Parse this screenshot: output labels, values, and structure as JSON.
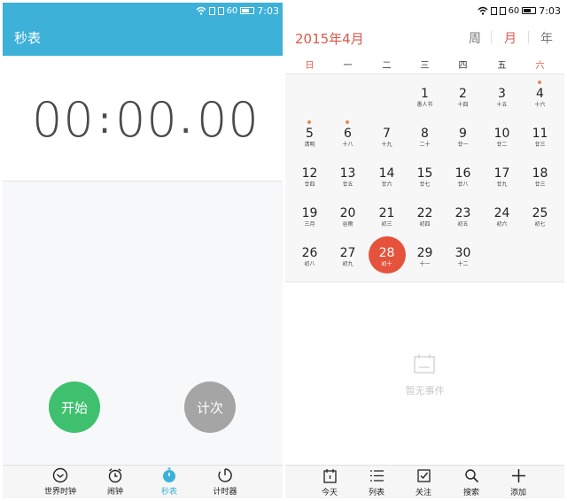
{
  "stopwatch": {
    "status": {
      "signal": "60",
      "time": "7:03"
    },
    "title": "秒表",
    "display": {
      "minutes": "00",
      "sep1": ":",
      "seconds": "00",
      "sep2": ".",
      "hundredths": "00"
    },
    "start_label": "开始",
    "lap_label": "计次",
    "tabs": [
      {
        "label": "世界时钟",
        "icon": "globe-clock-icon",
        "active": false
      },
      {
        "label": "闹钟",
        "icon": "alarm-icon",
        "active": false
      },
      {
        "label": "秒表",
        "icon": "stopwatch-icon",
        "active": true
      },
      {
        "label": "计时器",
        "icon": "timer-icon",
        "active": false
      }
    ],
    "colors": {
      "accent": "#3db1d8",
      "start": "#3fc06f",
      "lap": "#a5a5a5"
    }
  },
  "calendar": {
    "status": {
      "signal": "60",
      "time": "7:03"
    },
    "month_title": "2015年4月",
    "view_tabs": {
      "week": "周",
      "month": "月",
      "year": "年"
    },
    "weekdays": [
      "日",
      "一",
      "二",
      "三",
      "四",
      "五",
      "六"
    ],
    "days": [
      {
        "num": "1",
        "sub": "愚人节",
        "dot": false
      },
      {
        "num": "2",
        "sub": "十四",
        "dot": false
      },
      {
        "num": "3",
        "sub": "十五",
        "dot": false
      },
      {
        "num": "4",
        "sub": "十六",
        "dot": true
      },
      {
        "num": "5",
        "sub": "清明",
        "dot": true
      },
      {
        "num": "6",
        "sub": "十八",
        "dot": true
      },
      {
        "num": "7",
        "sub": "十九",
        "dot": false
      },
      {
        "num": "8",
        "sub": "二十",
        "dot": false
      },
      {
        "num": "9",
        "sub": "廿一",
        "dot": false
      },
      {
        "num": "10",
        "sub": "廿二",
        "dot": false
      },
      {
        "num": "11",
        "sub": "廿三",
        "dot": false
      },
      {
        "num": "12",
        "sub": "廿四",
        "dot": false
      },
      {
        "num": "13",
        "sub": "廿五",
        "dot": false
      },
      {
        "num": "14",
        "sub": "廿六",
        "dot": false
      },
      {
        "num": "15",
        "sub": "廿七",
        "dot": false
      },
      {
        "num": "16",
        "sub": "廿八",
        "dot": false
      },
      {
        "num": "17",
        "sub": "廿九",
        "dot": false
      },
      {
        "num": "18",
        "sub": "廿三",
        "dot": false
      },
      {
        "num": "19",
        "sub": "三月",
        "dot": false
      },
      {
        "num": "20",
        "sub": "谷雨",
        "dot": false
      },
      {
        "num": "21",
        "sub": "初三",
        "dot": false
      },
      {
        "num": "22",
        "sub": "初四",
        "dot": false
      },
      {
        "num": "23",
        "sub": "初五",
        "dot": false
      },
      {
        "num": "24",
        "sub": "初六",
        "dot": false
      },
      {
        "num": "25",
        "sub": "初七",
        "dot": false
      },
      {
        "num": "26",
        "sub": "初八",
        "dot": false
      },
      {
        "num": "27",
        "sub": "初九",
        "dot": false
      },
      {
        "num": "28",
        "sub": "初十",
        "dot": false,
        "selected": true
      },
      {
        "num": "29",
        "sub": "十一",
        "dot": false
      },
      {
        "num": "30",
        "sub": "十二",
        "dot": false
      }
    ],
    "empty_text": "暂无事件",
    "toolbar": [
      {
        "label": "今天",
        "icon": "today-icon"
      },
      {
        "label": "列表",
        "icon": "list-icon"
      },
      {
        "label": "关注",
        "icon": "checkbox-icon"
      },
      {
        "label": "搜索",
        "icon": "search-icon"
      },
      {
        "label": "添加",
        "icon": "plus-icon"
      }
    ],
    "colors": {
      "accent": "#d85a4c",
      "selected": "#e6533d"
    }
  }
}
